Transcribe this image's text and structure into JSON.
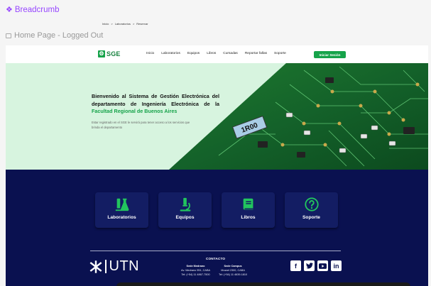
{
  "canvas": {
    "component_label": "Breadcrumb",
    "breadcrumb_items": [
      "Inicio",
      ">",
      "Laboratorios",
      ">",
      "Reservar"
    ],
    "frame_label": "Home Page - Logged Out"
  },
  "navbar": {
    "logo_text": "SGE",
    "links": [
      "Inicio",
      "Laboratorios",
      "Equipos",
      "Libros",
      "Cursadas",
      "Reportar fallas",
      "Soporte"
    ],
    "login_button": "Iniciar Sesión"
  },
  "hero": {
    "title_part1": "Bienvenido al Sistema de Gestión Electrónica del departamento de Ingeniería Electrónica de la ",
    "title_highlight": "Facultad Regional de Buenos Aires",
    "subtitle": "Estar registrado en el SGE le servirá para tener acceso a los servicios que brinda el departamento",
    "resistor_label": "1R00"
  },
  "cards": [
    {
      "label": "Laboratorios",
      "icon": "lab-icon"
    },
    {
      "label": "Equipos",
      "icon": "microscope-icon"
    },
    {
      "label": "Libros",
      "icon": "book-icon"
    },
    {
      "label": "Soporte",
      "icon": "help-icon"
    }
  ],
  "footer": {
    "logo_text": "UTN",
    "contact_title": "CONTACTO",
    "sedes": [
      {
        "name": "Sede Medrano",
        "address": "Av. Medrano 951, CABA",
        "phone": "Tel: (+54) 11 4867-7500"
      },
      {
        "name": "Sede Campus",
        "address": "Mozart 2300, CABA",
        "phone": "Tel: (+54) 11 4639-1810"
      }
    ],
    "socials": [
      "facebook-icon",
      "twitter-icon",
      "youtube-icon",
      "linkedin-icon"
    ]
  },
  "colors": {
    "accent": "#16a34a",
    "navy": "#0a1150",
    "card": "#131d63",
    "figma_purple": "#9747ff"
  }
}
